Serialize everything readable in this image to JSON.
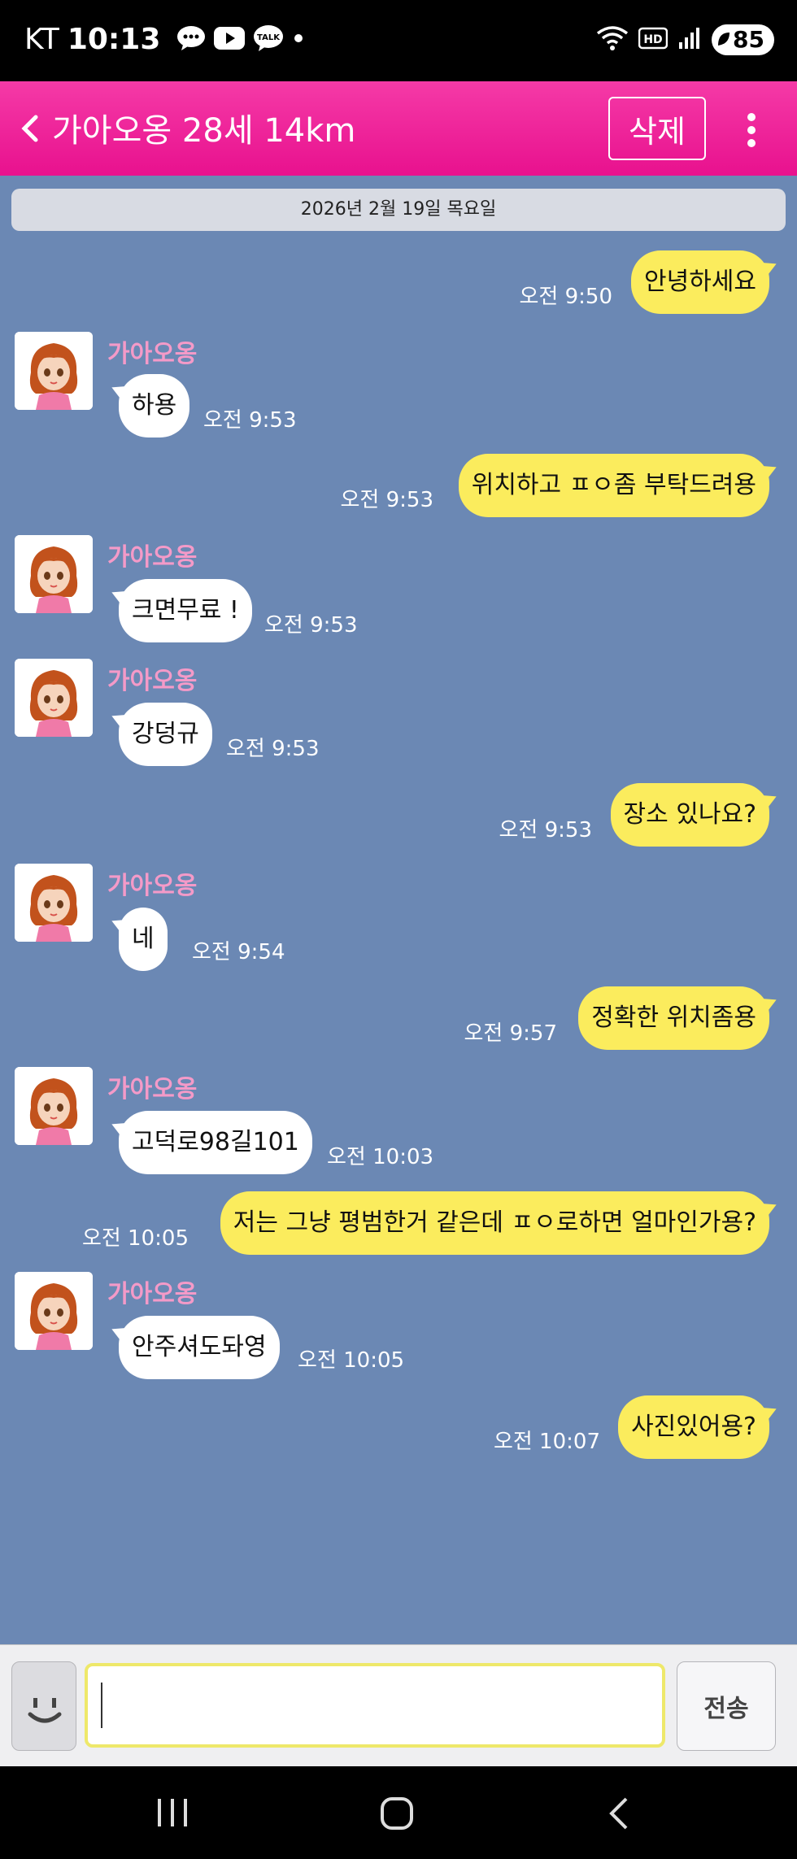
{
  "status_bar": {
    "carrier": "KT",
    "time": "10:13",
    "battery": "85",
    "icons": [
      "chat-icon",
      "youtube-icon",
      "kakaotalk-icon",
      "dot-icon",
      "wifi-icon",
      "hd-icon",
      "signal-icon",
      "battery-icon"
    ],
    "talk_label": "TALK",
    "hd_label": "HD"
  },
  "header": {
    "title": "가아오옹 28세 14km",
    "delete_label": "삭제",
    "accent": "#ee1b96"
  },
  "date": "2026년 2월 19일 목요일",
  "messages": [
    {
      "dir": "out",
      "text": "안녕하세요",
      "time": "오전 9:50"
    },
    {
      "dir": "in",
      "sender": "가아오옹",
      "text": "하용",
      "time": "오전 9:53"
    },
    {
      "dir": "out",
      "text": "위치하고 ㅍㅇ좀 부탁드려용",
      "time": "오전 9:53"
    },
    {
      "dir": "in",
      "sender": "가아오옹",
      "text": "크면무료 !",
      "time": "오전 9:53"
    },
    {
      "dir": "in",
      "sender": "가아오옹",
      "text": "강덩규",
      "time": "오전 9:53"
    },
    {
      "dir": "out",
      "text": "장소 있나요?",
      "time": "오전 9:53"
    },
    {
      "dir": "in",
      "sender": "가아오옹",
      "text": "네",
      "time": "오전 9:54"
    },
    {
      "dir": "out",
      "text": "정확한 위치좀용",
      "time": "오전 9:57"
    },
    {
      "dir": "in",
      "sender": "가아오옹",
      "text": "고덕로98길101",
      "time": "오전 10:03"
    },
    {
      "dir": "out",
      "text": "저는 그냥 평범한거 같은데 ㅍㅇ로하면 얼마인가용?",
      "time": "오전 10:05"
    },
    {
      "dir": "in",
      "sender": "가아오옹",
      "text": "안주셔도돠영",
      "time": "오전 10:05"
    },
    {
      "dir": "out",
      "text": "사진있어용?",
      "time": "오전 10:07"
    }
  ],
  "input": {
    "value": "",
    "send_label": "전송"
  },
  "colors": {
    "chat_bg": "#6b88b4",
    "outgoing_bubble": "#fbec5d",
    "incoming_bubble": "#ffffff",
    "sender_name": "#f49ac8"
  }
}
